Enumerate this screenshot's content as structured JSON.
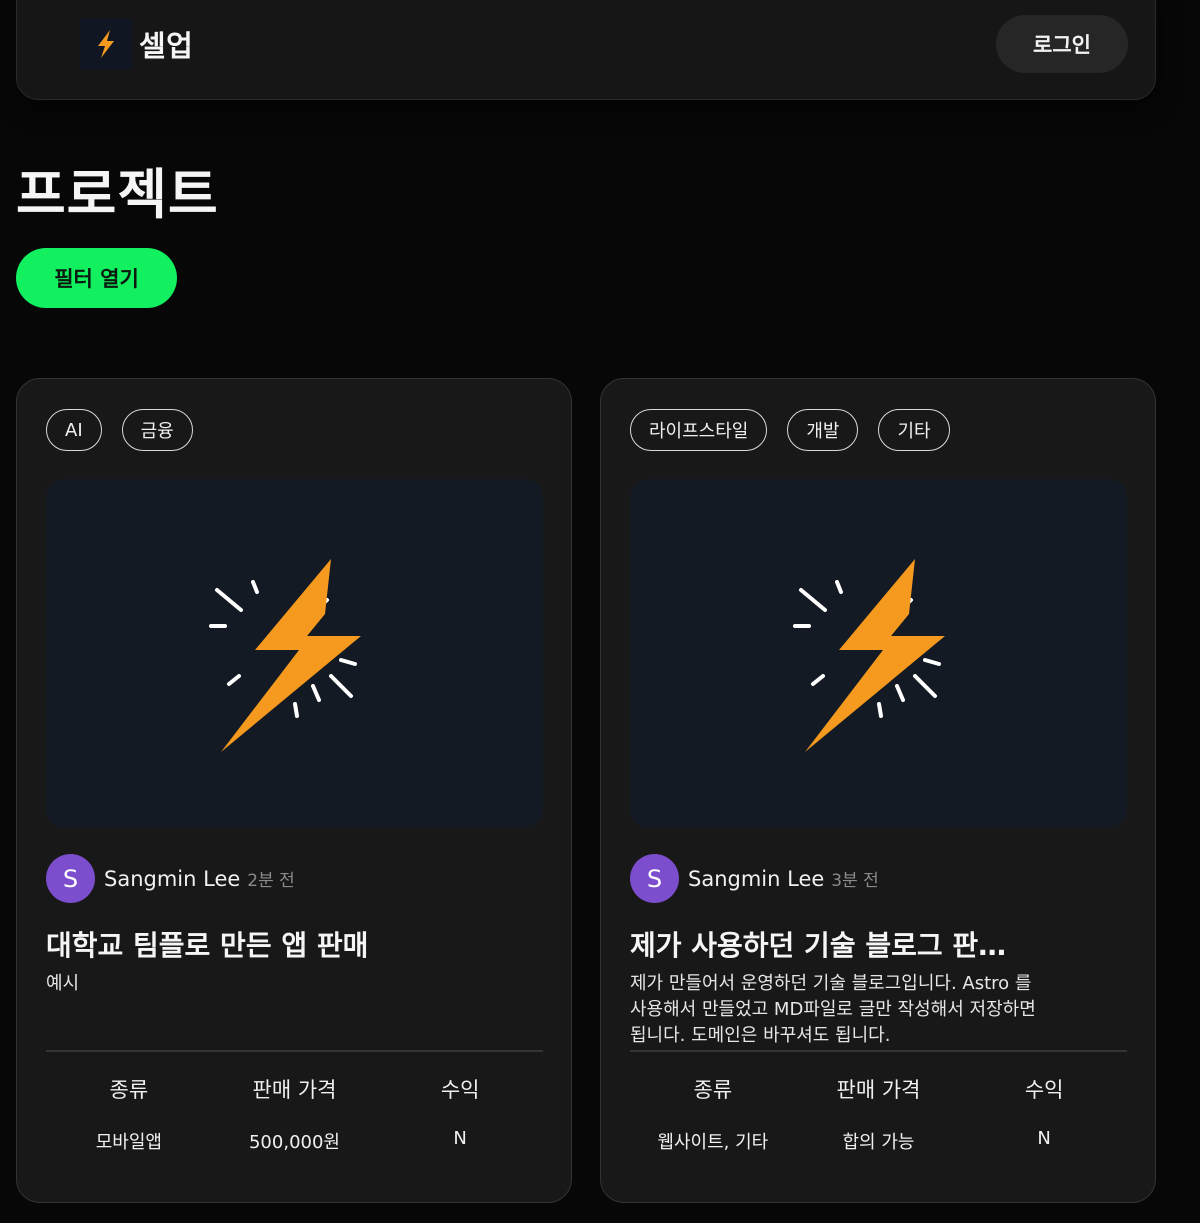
{
  "header": {
    "brand": "셀업",
    "logo_icon": "lightning-icon",
    "login_label": "로그인"
  },
  "page": {
    "title": "프로젝트",
    "filter_label": "필터 열기"
  },
  "colors": {
    "accent_green": "#12f060",
    "bolt_orange": "#f59a1f",
    "avatar_purple": "#7c4dcc"
  },
  "cards": [
    {
      "tags": [
        "AI",
        "금융"
      ],
      "thumbnail_icon": "lightning-icon",
      "author": {
        "initial": "S",
        "name": "Sangmin Lee",
        "time": "2분 전"
      },
      "title": "대학교 팀플로 만든 앱 판매",
      "description": "예시",
      "stat_labels": [
        "종류",
        "판매 가격",
        "수익"
      ],
      "stat_values": [
        "모바일앱",
        "500,000원",
        "N"
      ]
    },
    {
      "tags": [
        "라이프스타일",
        "개발",
        "기타"
      ],
      "thumbnail_icon": "lightning-icon",
      "author": {
        "initial": "S",
        "name": "Sangmin Lee",
        "time": "3분 전"
      },
      "title": "제가 사용하던 기술 블로그 판…",
      "description": "제가 만들어서 운영하던 기술 블로그입니다. Astro 를 사용해서 만들었고 MD파일로 글만 작성해서 저장하면 됩니다. 도메인은 바꾸셔도 됩니다.",
      "stat_labels": [
        "종류",
        "판매 가격",
        "수익"
      ],
      "stat_values": [
        "웹사이트, 기타",
        "합의 가능",
        "N"
      ]
    }
  ]
}
